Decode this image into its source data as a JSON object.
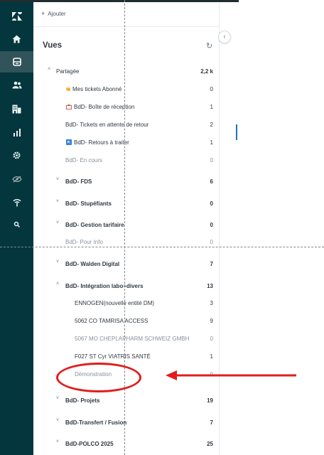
{
  "toolbar": {
    "add_label": "Ajouter",
    "add_icon": "plus-icon"
  },
  "views": {
    "title": "Vues",
    "refresh_icon": "refresh-icon",
    "collapse_icon": "chevron-left-icon",
    "rows": [
      {
        "label": "Partagée",
        "count": "2,2 k",
        "chevron": "˄"
      },
      {
        "label": "Mes tickets Abonné",
        "count": "0",
        "icon": "hand-emoji"
      },
      {
        "label": "BdD- Boîte de réception",
        "count": "1",
        "icon": "inbox-emoji"
      },
      {
        "label": "BdD- Tickets en attente de retour",
        "count": "2"
      },
      {
        "label": "BdD- Retours à traiter",
        "count": "1",
        "icon": "return-emoji"
      },
      {
        "label": "BdD- En cours",
        "count": "0"
      },
      {
        "label": "BdD- FDS",
        "count": "6",
        "chevron": "˅"
      },
      {
        "label": "BdD- Stupéfiants",
        "count": "0",
        "chevron": "˅"
      },
      {
        "label": "BdD- Gestion tarifaire",
        "count": "0",
        "chevron": "˅"
      },
      {
        "label": "BdD- Pour Info",
        "count": "0"
      },
      {
        "label": "BdD- Walden Digital",
        "count": "7",
        "chevron": "˅"
      },
      {
        "label": "BdD- Intégration labo+divers",
        "count": "13",
        "chevron": "˄"
      },
      {
        "label": "ENNOGEN(nouvelle entité DM)",
        "count": "3"
      },
      {
        "label": "5062 CO TAMRISA ACCESS",
        "count": "9"
      },
      {
        "label": "5067 MO CHEPLAPHARM SCHWEIZ GMBH",
        "count": "0"
      },
      {
        "label": "F027 ST Cyr VIATRIS SANTÉ",
        "count": "1"
      },
      {
        "label": "Démonstration",
        "count": "0"
      },
      {
        "label": "BdD- Projets",
        "count": "19",
        "chevron": "˅"
      },
      {
        "label": "BdD-Transfert / Fusion",
        "count": "7",
        "chevron": "˅"
      },
      {
        "label": "BdD-POLCO 2025",
        "count": "25",
        "chevron": "˅"
      }
    ]
  },
  "sidebar_icons": [
    "logo-icon",
    "home-icon",
    "views-icon",
    "customers-icon",
    "organizations-icon",
    "reporting-icon",
    "settings-icon",
    "hidden-icon",
    "apps-icon",
    "search-icon"
  ],
  "annotation": {
    "color": "#e21c1c"
  }
}
